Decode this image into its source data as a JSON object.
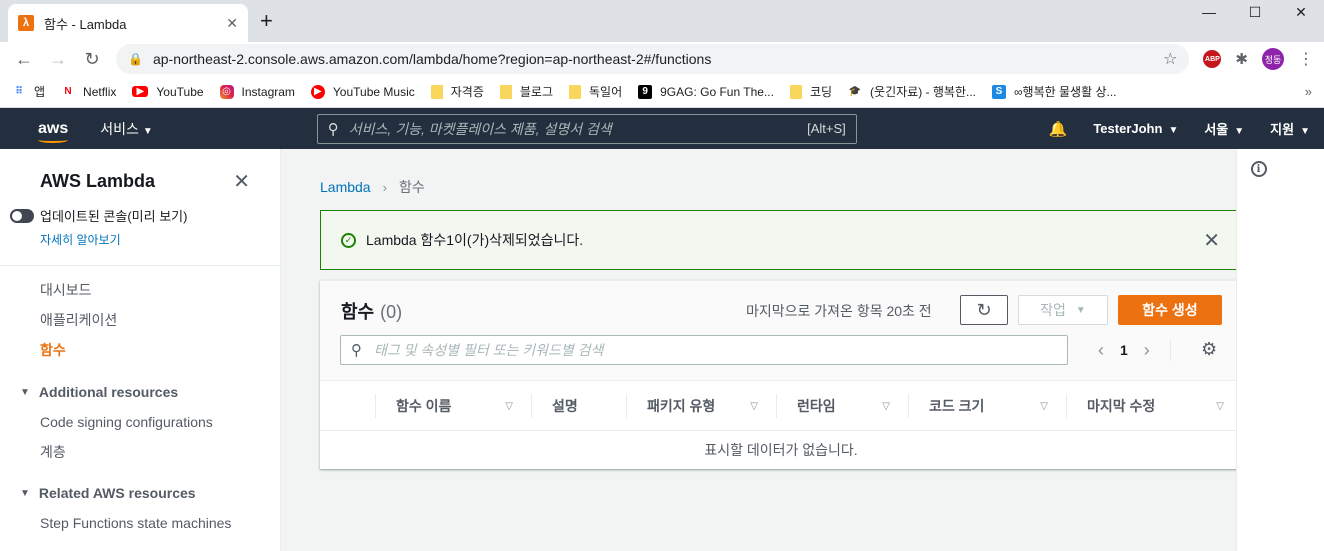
{
  "browser": {
    "tab_title": "함수 - Lambda",
    "tab_favicon": "λ",
    "url": "ap-northeast-2.console.aws.amazon.com/lambda/home?region=ap-northeast-2#/functions",
    "profile_label": "정동",
    "abp_label": "ABP",
    "bookmarks": [
      {
        "label": "앱",
        "icon": "apps-icon"
      },
      {
        "label": "Netflix",
        "icon": "netflix-icon"
      },
      {
        "label": "YouTube",
        "icon": "youtube-icon"
      },
      {
        "label": "Instagram",
        "icon": "instagram-icon"
      },
      {
        "label": "YouTube Music",
        "icon": "youtube-music-icon"
      },
      {
        "label": "자격증",
        "icon": "folder-icon"
      },
      {
        "label": "블로그",
        "icon": "folder-icon"
      },
      {
        "label": "독일어",
        "icon": "folder-icon"
      },
      {
        "label": "9GAG: Go Fun The...",
        "icon": "9gag-icon"
      },
      {
        "label": "코딩",
        "icon": "folder-icon"
      },
      {
        "label": "(웃긴자료) - 행복한...",
        "icon": "hat-icon"
      },
      {
        "label": "∞행복한 물생활 상...",
        "icon": "s-icon"
      }
    ]
  },
  "aws_header": {
    "logo": "aws",
    "services_label": "서비스",
    "search_placeholder": "서비스, 기능, 마켓플레이스 제품, 설명서 검색",
    "search_shortcut": "[Alt+S]",
    "user": "TesterJohn",
    "region": "서울",
    "support": "지원"
  },
  "sidebar": {
    "title": "AWS Lambda",
    "toggle_label": "업데이트된 콘솔(미리 보기)",
    "learn_more": "자세히 알아보기",
    "items": [
      {
        "label": "대시보드",
        "active": false
      },
      {
        "label": "애플리케이션",
        "active": false
      },
      {
        "label": "함수",
        "active": true
      }
    ],
    "sections": [
      {
        "title": "Additional resources",
        "items": [
          "Code signing configurations",
          "계층"
        ]
      },
      {
        "title": "Related AWS resources",
        "items": [
          "Step Functions state machines"
        ]
      }
    ]
  },
  "breadcrumb": {
    "root": "Lambda",
    "current": "함수"
  },
  "flash": {
    "message": "Lambda 함수1이(가)삭제되었습니다.",
    "color": "#1d8102"
  },
  "functions_panel": {
    "title": "함수",
    "count": "(0)",
    "last_fetched": "마지막으로 가져온 항목 20초 전",
    "actions_label": "작업",
    "create_label": "함수 생성",
    "filter_placeholder": "태그 및 속성별 필터 또는 키워드별 검색",
    "page": "1",
    "columns": [
      "함수 이름",
      "설명",
      "패키지 유형",
      "런타임",
      "코드 크기",
      "마지막 수정"
    ],
    "empty_text": "표시할 데이터가 없습니다."
  },
  "colors": {
    "aws_nav": "#232f3e",
    "accent": "#ec7211",
    "link": "#0073bb"
  }
}
